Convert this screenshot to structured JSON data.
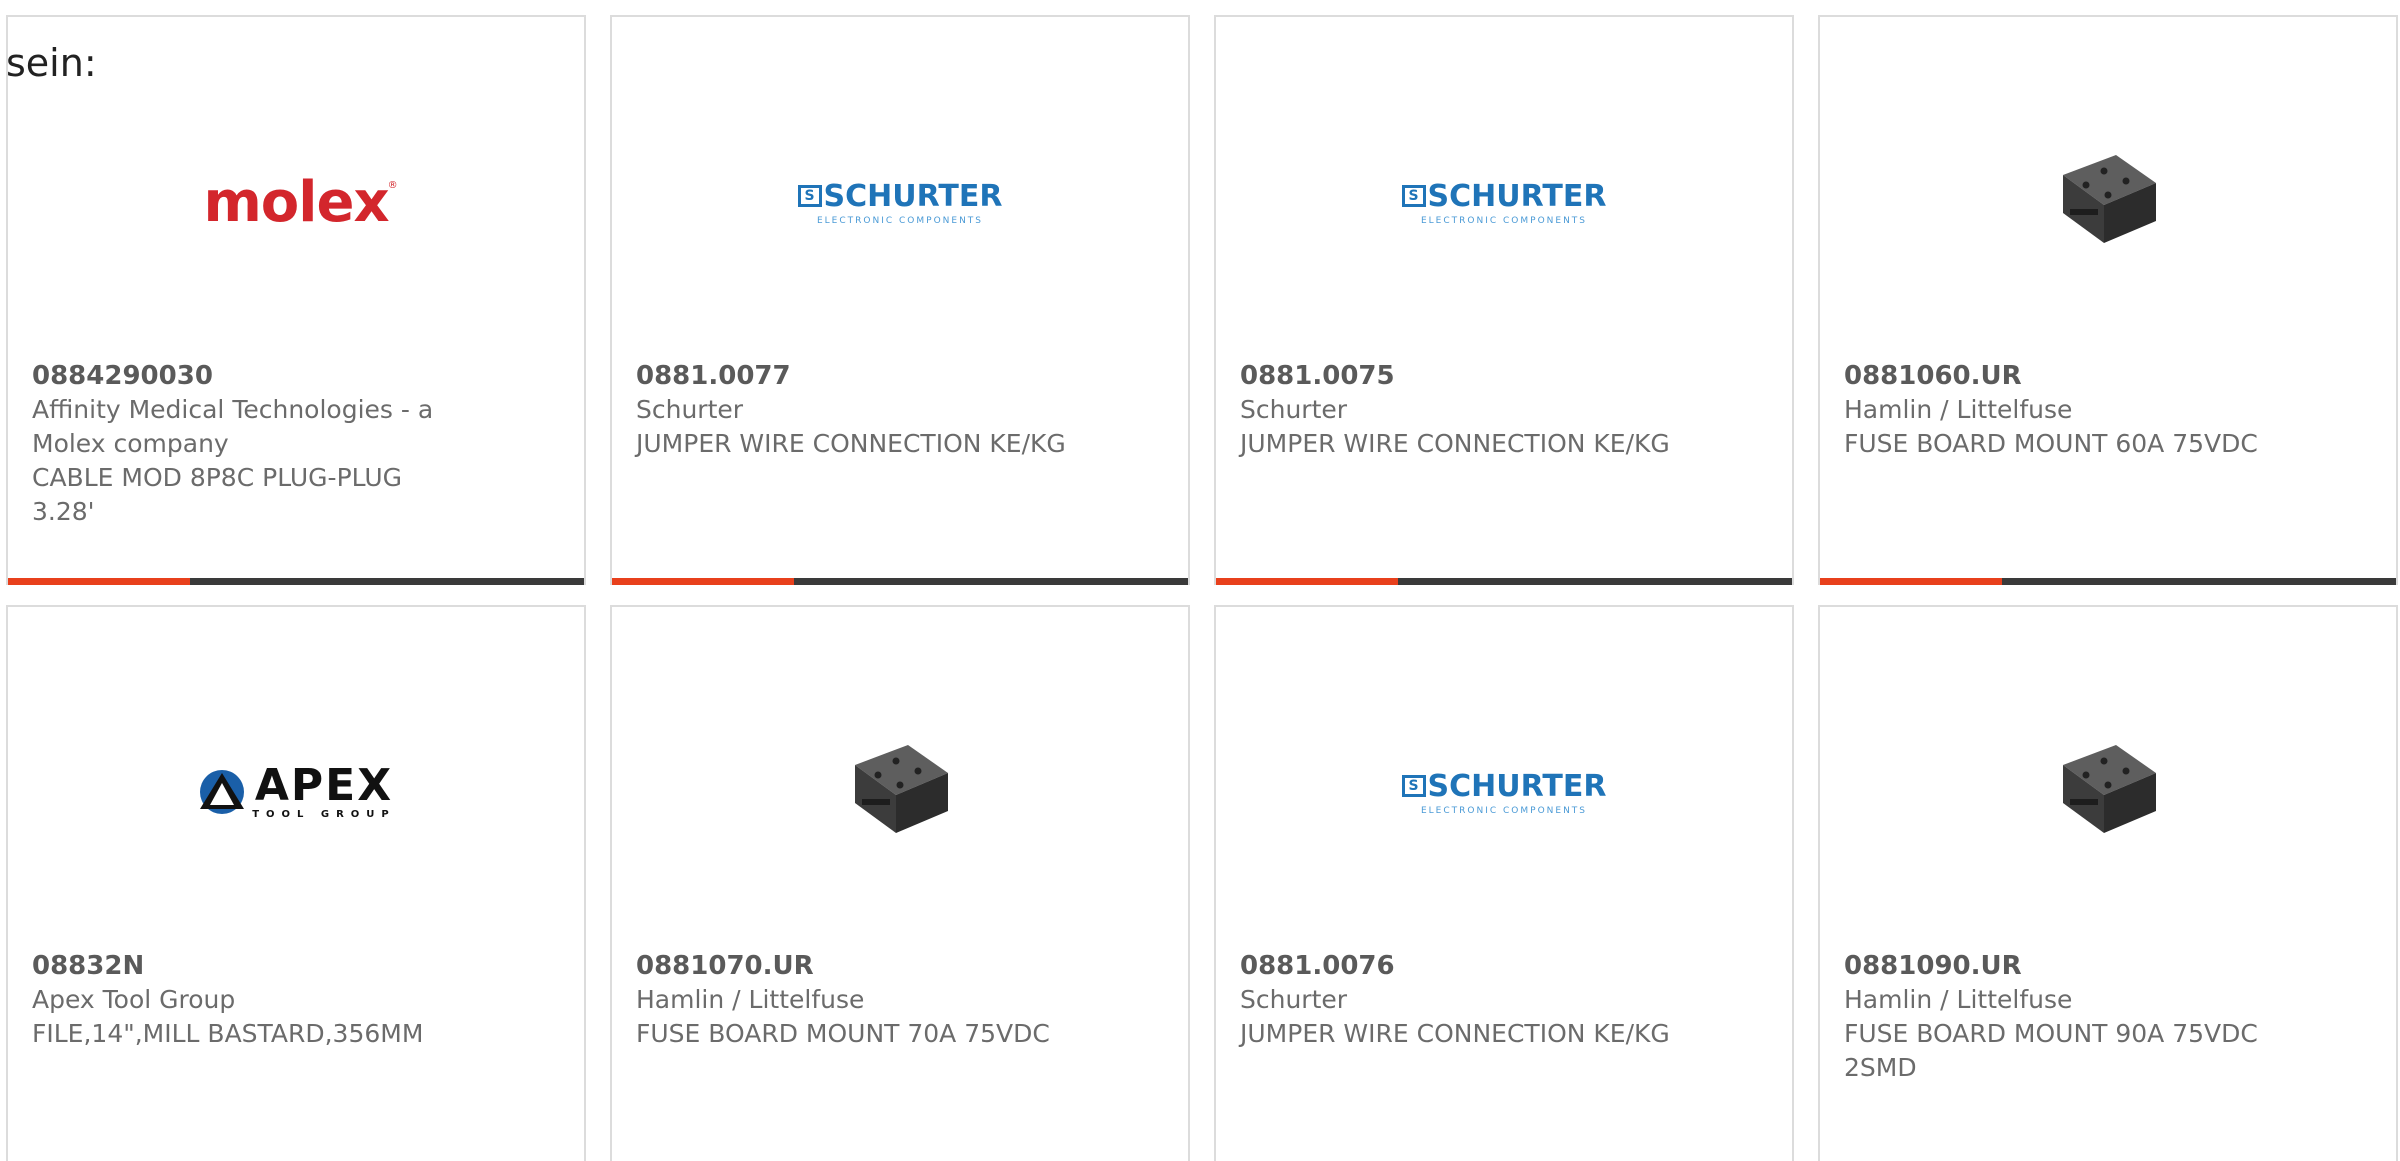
{
  "intro_text": "sein:",
  "colors": {
    "accent": "#e8401c",
    "bar": "#3a3a3a",
    "border": "#dcdcdc",
    "text": "#6b6b6b"
  },
  "products": [
    {
      "part_number": "0884290030",
      "manufacturer": "Affinity Medical Technologies - a Molex company",
      "description": "CABLE MOD 8P8C PLUG-PLUG 3.28'",
      "image": "molex-logo",
      "logo_text": "molex"
    },
    {
      "part_number": "0881.0077",
      "manufacturer": "Schurter",
      "description": "JUMPER WIRE CONNECTION KE/KG",
      "image": "schurter-logo",
      "logo_text": "SCHURTER",
      "logo_sub": "ELECTRONIC COMPONENTS"
    },
    {
      "part_number": "0881.0075",
      "manufacturer": "Schurter",
      "description": "JUMPER WIRE CONNECTION KE/KG",
      "image": "schurter-logo",
      "logo_text": "SCHURTER",
      "logo_sub": "ELECTRONIC COMPONENTS"
    },
    {
      "part_number": "0881060.UR",
      "manufacturer": "Hamlin / Littelfuse",
      "description": "FUSE BOARD MOUNT 60A 75VDC",
      "image": "fuse-block-photo"
    },
    {
      "part_number": "08832N",
      "manufacturer": "Apex Tool Group",
      "description": "FILE,14\",MILL BASTARD,356MM",
      "image": "apex-logo",
      "logo_text": "APEX",
      "logo_sub": "TOOL GROUP"
    },
    {
      "part_number": "0881070.UR",
      "manufacturer": "Hamlin / Littelfuse",
      "description": "FUSE BOARD MOUNT 70A 75VDC",
      "image": "fuse-block-photo"
    },
    {
      "part_number": "0881.0076",
      "manufacturer": "Schurter",
      "description": "JUMPER WIRE CONNECTION KE/KG",
      "image": "schurter-logo",
      "logo_text": "SCHURTER",
      "logo_sub": "ELECTRONIC COMPONENTS"
    },
    {
      "part_number": "0881090.UR",
      "manufacturer": "Hamlin / Littelfuse",
      "description": "FUSE BOARD MOUNT 90A 75VDC 2SMD",
      "image": "fuse-block-photo"
    }
  ]
}
